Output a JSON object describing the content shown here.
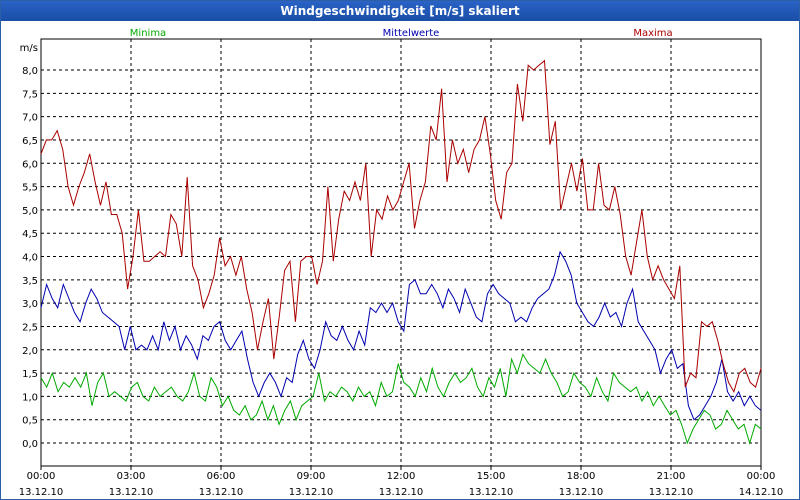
{
  "window": {
    "title": "Windgeschwindigkeit [m/s] skaliert"
  },
  "chart_data": {
    "type": "line",
    "title": "Windgeschwindigkeit [m/s] skaliert",
    "ylabel": "m/s",
    "ylim": [
      -0.2,
      8.5
    ],
    "xlim": [
      0,
      24
    ],
    "grid": true,
    "legend_position": "top",
    "y_ticks": [
      "0,0",
      "0,5",
      "1,0",
      "1,5",
      "2,0",
      "2,5",
      "3,0",
      "3,5",
      "4,0",
      "4,5",
      "5,0",
      "5,5",
      "6,0",
      "6,5",
      "7,0",
      "7,5",
      "8,0"
    ],
    "x_ticks": [
      {
        "time": "00:00",
        "date": "13.12.10"
      },
      {
        "time": "03:00",
        "date": "13.12.10"
      },
      {
        "time": "06:00",
        "date": "13.12.10"
      },
      {
        "time": "09:00",
        "date": "13.12.10"
      },
      {
        "time": "12:00",
        "date": "13.12.10"
      },
      {
        "time": "15:00",
        "date": "13.12.10"
      },
      {
        "time": "18:00",
        "date": "13.12.10"
      },
      {
        "time": "21:00",
        "date": "13.12.10"
      },
      {
        "time": "00:00",
        "date": "14.12.10"
      }
    ],
    "series": [
      {
        "name": "Minima",
        "color": "#00aa00",
        "values": [
          1.4,
          1.2,
          1.5,
          1.1,
          1.3,
          1.2,
          1.4,
          1.2,
          1.5,
          0.8,
          1.3,
          1.5,
          1.0,
          1.1,
          1.0,
          0.9,
          1.2,
          1.3,
          1.0,
          0.9,
          1.2,
          1.0,
          1.1,
          1.2,
          1.0,
          0.9,
          1.1,
          1.5,
          1.0,
          0.9,
          1.4,
          1.2,
          0.8,
          1.0,
          0.7,
          0.6,
          0.8,
          0.5,
          0.6,
          0.9,
          0.5,
          0.8,
          0.4,
          0.7,
          0.9,
          0.5,
          0.8,
          0.9,
          1.0,
          1.5,
          0.9,
          1.1,
          1.0,
          1.2,
          1.1,
          0.9,
          1.2,
          1.0,
          1.1,
          0.8,
          1.3,
          1.0,
          1.1,
          1.7,
          1.3,
          1.2,
          1.0,
          1.4,
          1.1,
          1.6,
          1.2,
          1.0,
          1.3,
          1.5,
          1.3,
          1.4,
          1.6,
          1.2,
          1.0,
          1.4,
          1.2,
          1.6,
          1.0,
          1.8,
          1.5,
          1.9,
          1.7,
          1.6,
          1.5,
          1.8,
          1.5,
          1.3,
          1.0,
          1.1,
          1.5,
          1.3,
          1.2,
          1.0,
          1.4,
          1.1,
          0.9,
          1.5,
          1.3,
          1.2,
          1.1,
          1.2,
          0.9,
          1.1,
          0.8,
          1.0,
          0.8,
          0.6,
          0.7,
          0.4,
          0.0,
          0.3,
          0.5,
          0.7,
          0.6,
          0.3,
          0.4,
          0.7,
          0.5,
          0.3,
          0.4,
          0.0,
          0.4,
          0.3
        ]
      },
      {
        "name": "Mittelwerte",
        "color": "#0000b0",
        "values": [
          2.9,
          3.4,
          3.1,
          2.9,
          3.4,
          3.1,
          2.8,
          2.6,
          3.0,
          3.3,
          3.1,
          2.8,
          2.7,
          2.6,
          2.5,
          2.0,
          2.5,
          2.0,
          2.1,
          2.0,
          2.3,
          2.0,
          2.6,
          2.2,
          2.5,
          2.0,
          2.3,
          2.1,
          1.8,
          2.3,
          2.2,
          2.5,
          2.6,
          2.2,
          2.0,
          2.2,
          2.4,
          1.8,
          1.3,
          1.0,
          1.3,
          1.5,
          1.3,
          1.0,
          1.4,
          1.3,
          1.9,
          2.2,
          1.8,
          1.6,
          2.0,
          2.6,
          2.3,
          2.2,
          2.5,
          2.2,
          2.0,
          2.4,
          2.1,
          2.9,
          2.8,
          3.0,
          2.8,
          3.0,
          2.6,
          2.4,
          3.4,
          3.5,
          3.2,
          3.2,
          3.4,
          3.2,
          2.9,
          3.3,
          3.1,
          2.8,
          3.3,
          3.0,
          2.7,
          2.6,
          3.2,
          3.4,
          3.2,
          3.1,
          3.0,
          2.6,
          2.7,
          2.6,
          2.9,
          3.1,
          3.2,
          3.3,
          3.6,
          4.1,
          3.9,
          3.6,
          3.0,
          2.8,
          2.6,
          2.5,
          2.7,
          3.0,
          2.7,
          2.8,
          2.5,
          3.0,
          3.3,
          2.6,
          2.4,
          2.2,
          2.0,
          1.5,
          1.8,
          2.0,
          1.6,
          1.7,
          0.8,
          0.5,
          0.6,
          0.8,
          1.0,
          1.3,
          1.8,
          1.1,
          0.9,
          1.1,
          0.8,
          1.0,
          0.8,
          0.7
        ]
      },
      {
        "name": "Maxima",
        "color": "#aa0000",
        "values": [
          6.2,
          6.5,
          6.5,
          6.7,
          6.3,
          5.5,
          5.1,
          5.5,
          5.8,
          6.2,
          5.6,
          5.1,
          5.6,
          4.9,
          4.9,
          4.5,
          3.3,
          4.0,
          5.0,
          3.9,
          3.9,
          4.0,
          4.1,
          4.0,
          4.9,
          4.7,
          4.0,
          5.7,
          3.8,
          3.5,
          2.9,
          3.2,
          3.6,
          4.4,
          3.8,
          4.0,
          3.6,
          4.0,
          3.3,
          2.8,
          2.0,
          2.6,
          3.1,
          1.8,
          2.7,
          3.7,
          3.9,
          2.6,
          3.9,
          4.0,
          4.0,
          3.4,
          3.9,
          5.5,
          3.9,
          4.8,
          5.4,
          5.2,
          5.6,
          5.2,
          6.0,
          4.0,
          5.0,
          4.8,
          5.3,
          5.0,
          5.2,
          5.6,
          6.0,
          4.6,
          5.2,
          5.6,
          6.8,
          6.5,
          7.6,
          5.6,
          6.5,
          6.0,
          6.3,
          5.8,
          6.3,
          6.5,
          7.0,
          6.2,
          5.2,
          4.8,
          5.8,
          6.0,
          7.7,
          6.9,
          8.1,
          8.0,
          8.1,
          8.2,
          6.4,
          6.9,
          5.0,
          5.5,
          6.0,
          5.4,
          6.1,
          5.0,
          5.0,
          6.0,
          5.1,
          5.0,
          5.5,
          4.9,
          4.0,
          3.6,
          4.3,
          5.0,
          4.0,
          3.5,
          3.8,
          3.5,
          3.3,
          3.1,
          3.8,
          1.2,
          1.5,
          1.4,
          2.6,
          2.5,
          2.6,
          2.2,
          1.7,
          1.3,
          1.1,
          1.5,
          1.6,
          1.3,
          1.2,
          1.6
        ]
      }
    ]
  }
}
